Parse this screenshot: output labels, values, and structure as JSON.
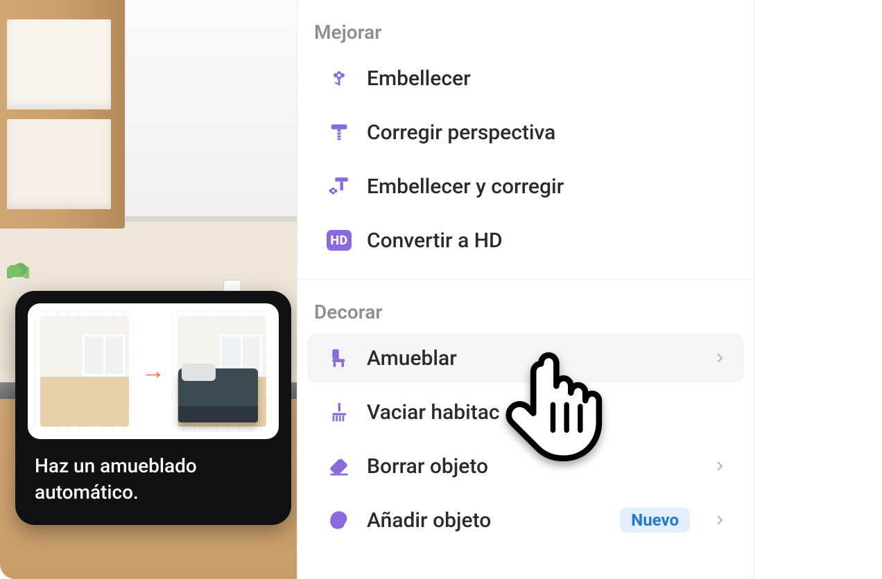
{
  "sections": {
    "improve": {
      "label": "Mejorar",
      "items": {
        "beautify": {
          "label": "Embellecer"
        },
        "perspective": {
          "label": "Corregir perspectiva"
        },
        "both": {
          "label": "Embellecer y corregir"
        },
        "hd": {
          "label": "Convertir a HD",
          "icon_text": "HD"
        }
      }
    },
    "decorate": {
      "label": "Decorar",
      "items": {
        "furnish": {
          "label": "Amueblar"
        },
        "empty": {
          "label": "Vaciar habitac"
        },
        "erase": {
          "label": "Borrar objeto"
        },
        "add": {
          "label": "Añadir objeto",
          "badge": "Nuevo"
        }
      }
    }
  },
  "tooltip": {
    "text": "Haz un amueblado automático.",
    "arrow": "→"
  }
}
